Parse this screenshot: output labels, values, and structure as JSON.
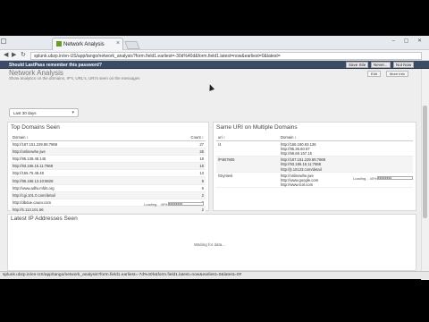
{
  "browser": {
    "tab_title": "Network Analysis",
    "url": "splunk.ubzp.in/en-US/app/tango/network_analysis?form.field1.earliest=-30d%40d&form.field1.latest=now&earliest=0&latest=",
    "status_url": "splunk.ubzp.in/en-US/app/tango/network_analysis?form.field1.earliest=-7d%40h&form.field1.latest=now&earliest=0&latest=0#"
  },
  "lastpass": {
    "message": "Should LastPass remember this password?",
    "buttons": [
      "Save Site",
      "Never...",
      "Not Now"
    ]
  },
  "header": {
    "title": "Network Analysis",
    "subtitle": "Show analytics on the domains, IP's, URL's, URI's seen on the messages",
    "edit_label": "Edit",
    "more_label": "More Info"
  },
  "time_picker": {
    "value": "Last 30 days"
  },
  "top_domains": {
    "title": "Top Domains Seen",
    "columns": [
      "Domain",
      "Count"
    ],
    "rows": [
      {
        "domain": "http://187.151.229.86:7868",
        "count": "27"
      },
      {
        "domain": "http://onlinewhe.jwe",
        "count": "26"
      },
      {
        "domain": "http://95.138.48.145",
        "count": "19"
      },
      {
        "domain": "http://93.186.15.11:7868",
        "count": "16"
      },
      {
        "domain": "http://155.75.48.48",
        "count": "13"
      },
      {
        "domain": "http://95.186.13.10:8828",
        "count": "8"
      },
      {
        "domain": "http://www.adfw.mfds.org",
        "count": "6"
      },
      {
        "domain": "http://cgi.101.0.com/detail",
        "count": "2"
      },
      {
        "domain": "http://dbdue.caucv.com",
        "count": "2"
      },
      {
        "domain": "http://5.113.101.66",
        "count": "2"
      }
    ],
    "loading": "Loading... 40%",
    "progress": 0.4
  },
  "same_uri": {
    "title": "Same URI on Multiple Domains",
    "columns": [
      "uri",
      "Domain"
    ],
    "rows": [
      {
        "uri": "/4",
        "domains": [
          "http://166.180.93.136",
          "http://95.36.60.67",
          "http://68.69.157.15"
        ]
      },
      {
        "uri": "/P4B7905",
        "domains": [
          "http://187.151.229.86:7868",
          "http://93.186.15.11:7868",
          "http://jt.10123.com/detail"
        ]
      },
      {
        "uri": "/Giymesi",
        "domains": [
          "http://onlinewhe.jwe",
          "http://www.google.com",
          "http://www.tcol.com"
        ]
      }
    ],
    "loading": "Loading... 40%",
    "progress": 0.4
  },
  "latest_ips": {
    "title": "Latest IP Addresses Seen",
    "waiting": "Waiting for data..."
  }
}
